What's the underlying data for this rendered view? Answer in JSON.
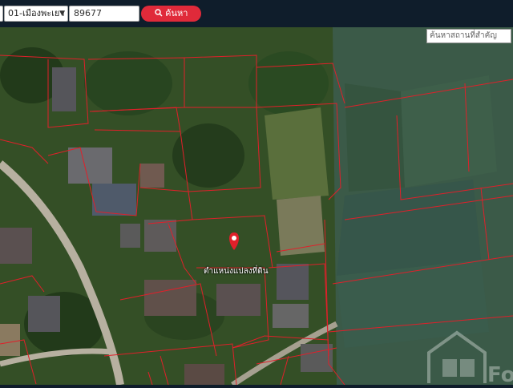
{
  "toolbar": {
    "district_select": "",
    "subdistrict_select": "01-เมืองพะเยา",
    "parcel_number": "89677",
    "search_button": "ค้นหา"
  },
  "map": {
    "place_search_placeholder": "ค้นหาสถานที่สำคัญ",
    "parcel_label": "ตำแหน่งแปลงที่ดิน",
    "watermark": "Fo"
  },
  "colors": {
    "parcel_lines": "#e0202a",
    "search_button": "#e02a3a",
    "toolbar_bg": "#0f1d2b",
    "marker": "#e0202a"
  },
  "icons": [
    "search-icon",
    "map-marker-icon",
    "chevron-down-icon"
  ]
}
